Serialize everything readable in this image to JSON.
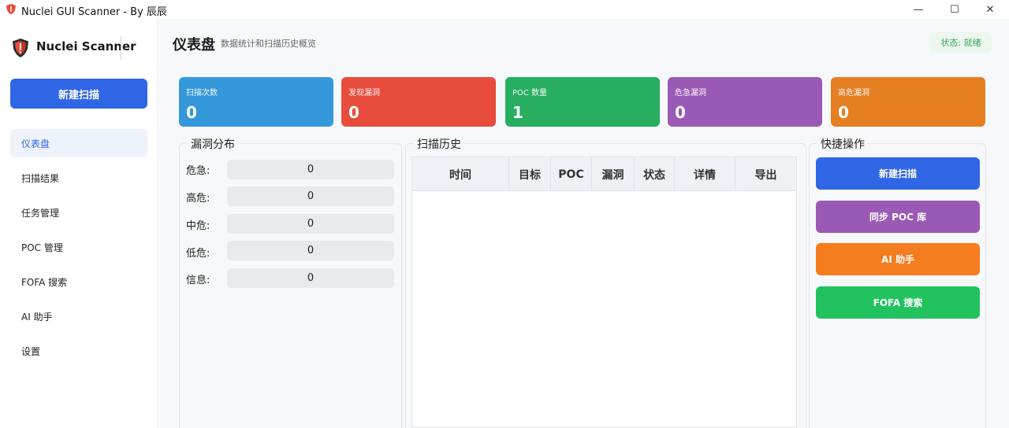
{
  "window": {
    "title": "Nuclei GUI Scanner - By 辰辰",
    "min": "—",
    "max": "☐",
    "close": "✕"
  },
  "sidebar": {
    "logo_text": "Nuclei Scanner",
    "new_scan": "新建扫描",
    "items": [
      {
        "label": "仪表盘"
      },
      {
        "label": "扫描结果"
      },
      {
        "label": "任务管理"
      },
      {
        "label": "POC 管理"
      },
      {
        "label": "FOFA 搜索"
      },
      {
        "label": "AI 助手"
      },
      {
        "label": "设置"
      }
    ]
  },
  "header": {
    "title": "仪表盘",
    "subtitle": "数据统计和扫描历史概览",
    "status": "状态: 就绪"
  },
  "cards": [
    {
      "label": "扫描次数",
      "value": "0",
      "color": "#3598db"
    },
    {
      "label": "发现漏洞",
      "value": "0",
      "color": "#e74c3c"
    },
    {
      "label": "POC 数量",
      "value": "1",
      "color": "#27ae60"
    },
    {
      "label": "危急漏洞",
      "value": "0",
      "color": "#9b59b6"
    },
    {
      "label": "高危漏洞",
      "value": "0",
      "color": "#e67e22"
    }
  ],
  "vuln_dist": {
    "title": "漏洞分布",
    "rows": [
      {
        "label": "危急:",
        "value": "0"
      },
      {
        "label": "高危:",
        "value": "0"
      },
      {
        "label": "中危:",
        "value": "0"
      },
      {
        "label": "低危:",
        "value": "0"
      },
      {
        "label": "信息:",
        "value": "0"
      }
    ]
  },
  "history": {
    "title": "扫描历史",
    "columns": [
      "时间",
      "目标",
      "POC",
      "漏洞",
      "状态",
      "详情",
      "导出"
    ]
  },
  "quick_actions": {
    "title": "快捷操作",
    "buttons": [
      {
        "label": "新建扫描",
        "color": "#2f66e5"
      },
      {
        "label": "同步 POC 库",
        "color": "#9b59b6"
      },
      {
        "label": "AI 助手",
        "color": "#f57c1f"
      },
      {
        "label": "FOFA 搜索",
        "color": "#22c35e"
      }
    ]
  }
}
